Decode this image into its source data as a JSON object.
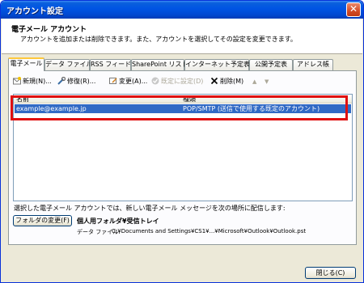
{
  "window": {
    "title": "アカウント設定",
    "close_glyph": "✕"
  },
  "header": {
    "title": "電子メール アカウント",
    "description": "アカウントを追加または削除できます。また、アカウントを選択してその設定を変更できます。"
  },
  "tabs": [
    {
      "label": "電子メール",
      "active": true
    },
    {
      "label": "データ ファイル",
      "active": false
    },
    {
      "label": "RSS フィード",
      "active": false
    },
    {
      "label": "SharePoint リスト",
      "active": false
    },
    {
      "label": "インターネット予定表",
      "active": false
    },
    {
      "label": "公開予定表",
      "active": false
    },
    {
      "label": "アドレス帳",
      "active": false
    }
  ],
  "toolbar": {
    "new_label": "新規(N)...",
    "repair_label": "修復(R)...",
    "change_label": "変更(A)...",
    "default_label": "既定に設定(D)",
    "delete_label": "削除(M)",
    "up_glyph": "▲",
    "down_glyph": "▼"
  },
  "list": {
    "columns": [
      "名前",
      "種類"
    ],
    "rows": [
      {
        "name": "example@example.jp",
        "type": "POP/SMTP (送信で使用する既定のアカウント)"
      }
    ]
  },
  "delivery": {
    "label": "選択した電子メール アカウントでは、新しい電子メール メッセージを次の場所に配信します:",
    "change_folder_label": "フォルダの変更(F)",
    "folder_name": "個人用フォルダ¥受信トレイ",
    "datafile_label": "データ ファイル:",
    "datafile_path": "C:¥Documents and Settings¥CS1¥...¥Microsoft¥Outlook¥Outlook.pst"
  },
  "footer": {
    "close_label": "閉じる(C)"
  },
  "colors": {
    "selection": "#316ac5",
    "highlight_box": "#e01010",
    "titlebar": "#0054e3"
  }
}
